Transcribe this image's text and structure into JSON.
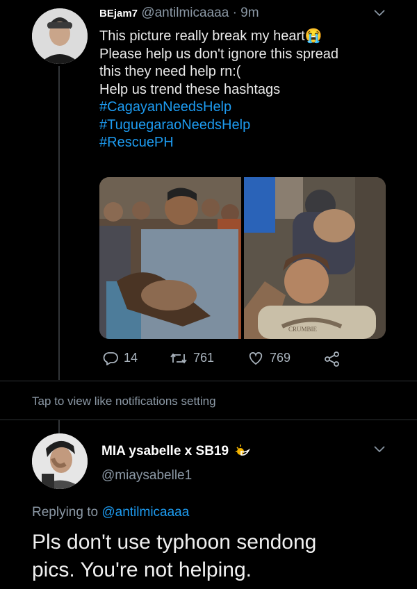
{
  "tweet": {
    "display_name": "BEjam7",
    "handle": "@antilmicaaaa",
    "separator": "·",
    "time": "9m",
    "lines": [
      "This picture really break my heart😭",
      "Please help us don't ignore this spread",
      "this they need help rn:(",
      "Help us trend these hashtags"
    ],
    "hashtags": [
      "#CagayanNeedsHelp",
      "#TuguegaraoNeedsHelp",
      "#RescuePH"
    ],
    "stats": {
      "replies": "14",
      "retweets": "761",
      "likes": "769"
    },
    "media_shirt_text": "CRUMBIE"
  },
  "notification_setting": "Tap to view like notifications setting",
  "reply": {
    "display_name": "MIA ysabelle x SB19",
    "handle": "@miaysabelle1",
    "replying_prefix": "Replying to",
    "replying_to": "@antilmicaaaa",
    "text_lines": [
      "Pls don't use typhoon sendong",
      "pics. You're not helping."
    ]
  },
  "colors": {
    "link": "#1d9bf0",
    "muted": "#8b98a5",
    "background": "#000000"
  },
  "icons": [
    "chevron-down-icon",
    "reply-icon",
    "retweet-icon",
    "like-icon",
    "share-icon",
    "sun-emoji-icon"
  ]
}
